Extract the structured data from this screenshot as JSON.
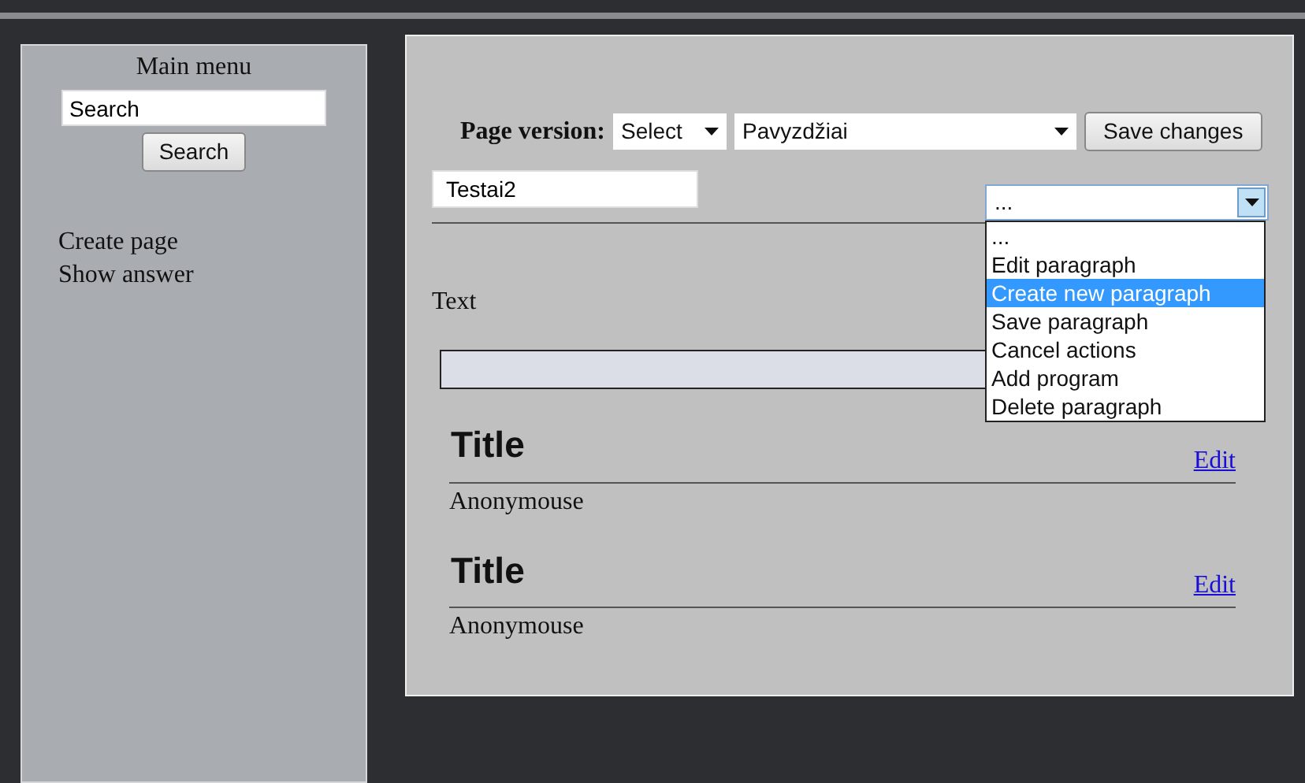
{
  "sidebar": {
    "title": "Main menu",
    "search": {
      "value": "Search"
    },
    "search_button": "Search",
    "links": [
      "Create page",
      "Show answer"
    ]
  },
  "toolbar": {
    "label": "Page version:",
    "version_select": "Select",
    "page_select": "Pavyzdžiai",
    "save_button": "Save changes"
  },
  "name_field": {
    "value": "Testai2"
  },
  "action_select": {
    "value": "...",
    "expanded": true,
    "options": [
      {
        "label": "...",
        "highlighted": false
      },
      {
        "label": "Edit paragraph",
        "highlighted": false
      },
      {
        "label": "Create new paragraph",
        "highlighted": true
      },
      {
        "label": "Save paragraph",
        "highlighted": false
      },
      {
        "label": "Cancel actions",
        "highlighted": false
      },
      {
        "label": "Add program",
        "highlighted": false
      },
      {
        "label": "Delete paragraph",
        "highlighted": false
      }
    ]
  },
  "text_label": "Text",
  "paragraphs": [
    {
      "title": "Title",
      "edit": "Edit",
      "author": "Anonymouse"
    },
    {
      "title": "Title",
      "edit": "Edit",
      "author": "Anonymouse"
    }
  ]
}
